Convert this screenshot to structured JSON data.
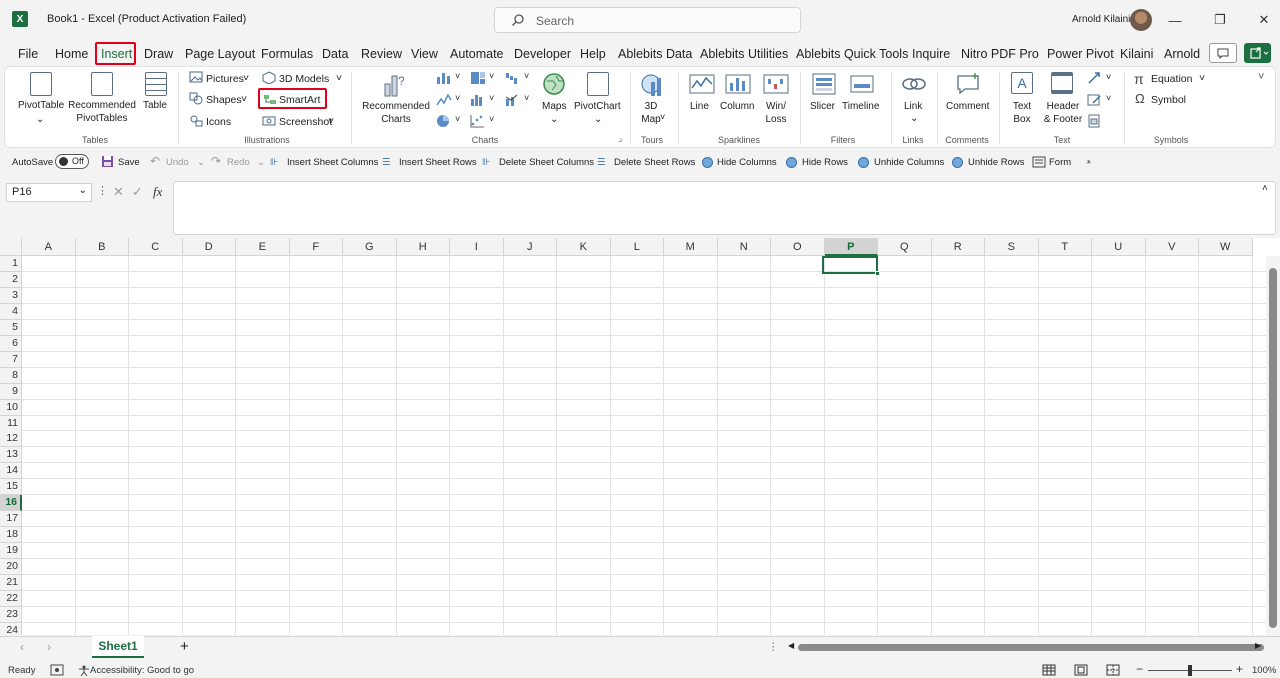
{
  "window": {
    "app_icon": "X",
    "title": "Book1  -  Excel (Product Activation Failed)",
    "search_placeholder": "Search",
    "user_name": "Arnold Kilaini",
    "min": "—",
    "restore": "❐",
    "close": "✕"
  },
  "menu": {
    "tabs": [
      "File",
      "Home",
      "Insert",
      "Draw",
      "Page Layout",
      "Formulas",
      "Data",
      "Review",
      "View",
      "Automate",
      "Developer",
      "Help",
      "Ablebits Data",
      "Ablebits Utilities",
      "Ablebits Quick Tools",
      "Inquire",
      "Nitro PDF Pro",
      "Power Pivot",
      "Kilaini",
      "Arnold"
    ],
    "active": "Insert"
  },
  "ribbon": {
    "tables": {
      "pivottable": "PivotTable",
      "recommended_pivot": "Recommended\nPivotTables",
      "table": "Table",
      "group": "Tables"
    },
    "illustrations": {
      "pictures": "Pictures",
      "shapes": "Shapes",
      "icons": "Icons",
      "models": "3D Models",
      "smartart": "SmartArt",
      "screenshot": "Screenshot",
      "group": "Illustrations"
    },
    "charts": {
      "recommended": "Recommended\nCharts",
      "maps": "Maps",
      "pivotchart": "PivotChart",
      "group": "Charts"
    },
    "tours": {
      "map3d": "3D\nMap",
      "group": "Tours"
    },
    "sparklines": {
      "line": "Line",
      "column": "Column",
      "winloss": "Win/\nLoss",
      "group": "Sparklines"
    },
    "filters": {
      "slicer": "Slicer",
      "timeline": "Timeline",
      "group": "Filters"
    },
    "links": {
      "link": "Link",
      "group": "Links"
    },
    "comments": {
      "comment": "Comment",
      "group": "Comments"
    },
    "text": {
      "textbox": "Text\nBox",
      "header": "Header\n& Footer",
      "group": "Text"
    },
    "symbols": {
      "equation": "Equation",
      "symbol": "Symbol",
      "group": "Symbols"
    }
  },
  "qat": {
    "autosave": "AutoSave",
    "toggle": "Off",
    "save": "Save",
    "undo": "Undo",
    "redo": "Redo",
    "insert_cols": "Insert Sheet Columns",
    "insert_rows": "Insert Sheet Rows",
    "delete_cols": "Delete Sheet Columns",
    "delete_rows": "Delete Sheet Rows",
    "hide_cols": "Hide Columns",
    "hide_rows": "Hide Rows",
    "unhide_cols": "Unhide Columns",
    "unhide_rows": "Unhide Rows",
    "form": "Form"
  },
  "formula_bar": {
    "name_box": "P16",
    "fx": "fx",
    "formula": ""
  },
  "grid": {
    "columns": [
      "A",
      "B",
      "C",
      "D",
      "E",
      "F",
      "G",
      "H",
      "I",
      "J",
      "K",
      "L",
      "M",
      "N",
      "O",
      "P",
      "Q",
      "R",
      "S",
      "T",
      "U",
      "V",
      "W"
    ],
    "rows": [
      "1",
      "2",
      "3",
      "4",
      "5",
      "6",
      "7",
      "8",
      "9",
      "10",
      "11",
      "12",
      "13",
      "14",
      "15",
      "16",
      "17",
      "18",
      "19",
      "20",
      "21",
      "22",
      "23",
      "24"
    ],
    "selected_column": "P",
    "selected_row": "16"
  },
  "sheets": {
    "tabs": [
      "Sheet1"
    ],
    "add": "+"
  },
  "status": {
    "ready": "Ready",
    "accessibility": "Accessibility: Good to go",
    "zoom": "100%",
    "minus": "−",
    "plus": "+"
  },
  "colors": {
    "accent": "#1d6f42",
    "highlight": "#e0001b"
  }
}
